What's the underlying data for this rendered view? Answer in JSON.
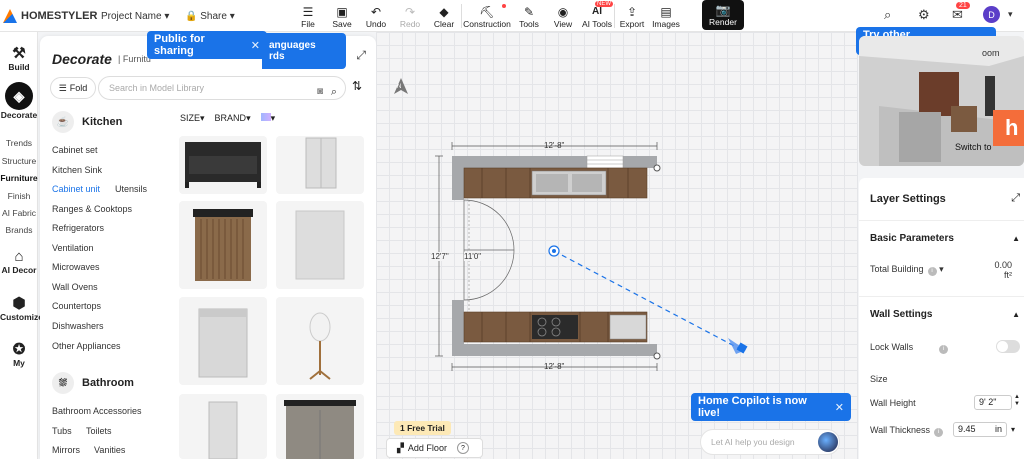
{
  "app": {
    "name": "HOMESTYLER",
    "project_name": "Project Name",
    "share_label": "Share"
  },
  "toolbar": {
    "items": [
      {
        "label": "File",
        "icon": "file-icon"
      },
      {
        "label": "Save",
        "icon": "save-icon"
      },
      {
        "label": "Undo",
        "icon": "undo-icon"
      },
      {
        "label": "Redo",
        "icon": "redo-icon"
      },
      {
        "label": "Clear",
        "icon": "eraser-icon"
      },
      {
        "label": "Construction",
        "icon": "construction-icon"
      },
      {
        "label": "Tools",
        "icon": "tools-icon"
      },
      {
        "label": "View",
        "icon": "eye-icon"
      },
      {
        "label": "AI Tools",
        "icon": "ai-icon",
        "badge": "NEW"
      },
      {
        "label": "Export",
        "icon": "export-icon"
      },
      {
        "label": "Images",
        "icon": "image-icon"
      },
      {
        "label": "Render",
        "icon": "camera-icon"
      }
    ],
    "notification_count": "21",
    "avatar_initial": "D"
  },
  "rail": {
    "build": "Build",
    "decorate": "Decorate",
    "sub": [
      "Trends",
      "Structure",
      "Furniture",
      "Finish",
      "AI Fabric",
      "Brands"
    ],
    "ai_decor": "AI Decor",
    "customize": "Customize",
    "my": "My"
  },
  "panel": {
    "title": "Decorate",
    "subtitle": "Furnitu",
    "fold_label": "Fold",
    "search_placeholder": "Search in Model Library",
    "filters": {
      "size": "SIZE",
      "brand": "BRAND"
    },
    "kitchen": {
      "title": "Kitchen",
      "items": [
        "Cabinet set",
        "Kitchen Sink",
        "Cabinet unit",
        "Utensils",
        "Ranges & Cooktops",
        "Refrigerators",
        "Ventilation",
        "Microwaves",
        "Wall Ovens",
        "Countertops",
        "Dishwashers",
        "Other Appliances"
      ]
    },
    "bathroom": {
      "title": "Bathroom",
      "items": [
        "Bathroom Accessories",
        "Tubs",
        "Toilets",
        "Mirrors",
        "Vanities"
      ]
    }
  },
  "tooltips": {
    "sharing": "Public for sharing",
    "languages_left_fragments": [
      "anguages",
      "rds"
    ],
    "languages_right": "Try other Languages!",
    "copilot": "Home Copilot is now live!"
  },
  "canvas": {
    "dim_top": "12'-8\"",
    "dim_bottom": "12'-8\"",
    "dim_left": "12'7\"",
    "dim_inner": "11'0\"",
    "free_trial": "1 Free Trial",
    "add_floor": "Add Floor",
    "north": "N",
    "copilot_placeholder": "Let AI help you design"
  },
  "preview": {
    "room_fragment": "oom",
    "switch_to": "Switch to",
    "brand_letter": "h"
  },
  "layer_settings": {
    "title": "Layer Settings",
    "basic": "Basic Parameters",
    "total_building_label": "Total Building",
    "total_building_value": "0.00",
    "total_building_unit": "ft²",
    "wall_settings": "Wall Settings",
    "lock_walls": "Lock Walls",
    "size": "Size",
    "wall_height_label": "Wall Height",
    "wall_height_value": "9' 2\"",
    "wall_thickness_label": "Wall Thickness",
    "wall_thickness_value": "9.45",
    "wall_thickness_unit": "in"
  },
  "colors": {
    "accent": "#1a73e8",
    "render_bg": "#111111",
    "trial_bg": "#fde9b6",
    "brand_orange": "#f46d3a"
  }
}
